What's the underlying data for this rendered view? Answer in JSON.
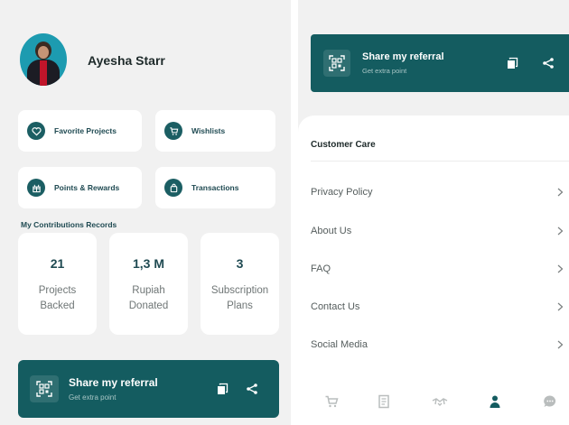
{
  "profile": {
    "name": "Ayesha Starr"
  },
  "menu": [
    {
      "label": "Favorite Projects",
      "icon": "heart-icon"
    },
    {
      "label": "Wishlists",
      "icon": "cart-icon"
    },
    {
      "label": "Points & Rewards",
      "icon": "gift-icon"
    },
    {
      "label": "Transactions",
      "icon": "bag-icon"
    }
  ],
  "contributions": {
    "title": "My Contributions Records",
    "stats": [
      {
        "value": "21",
        "label": "Projects Backed"
      },
      {
        "value": "1,3 M",
        "label": "Rupiah Donated"
      },
      {
        "value": "3",
        "label": "Subscription Plans"
      }
    ]
  },
  "referral": {
    "title": "Share my referral",
    "subtitle": "Get extra point"
  },
  "customer_care": {
    "title": "Customer Care",
    "items": [
      "Privacy Policy",
      "About Us",
      "FAQ",
      "Contact Us",
      "Social Media"
    ]
  },
  "bottom_nav": [
    "cart-icon",
    "document-icon",
    "handshake-icon",
    "profile-icon",
    "chat-icon"
  ],
  "colors": {
    "primary": "#145c60",
    "accent_text": "#1f4a52",
    "background": "#f1f1f1"
  }
}
